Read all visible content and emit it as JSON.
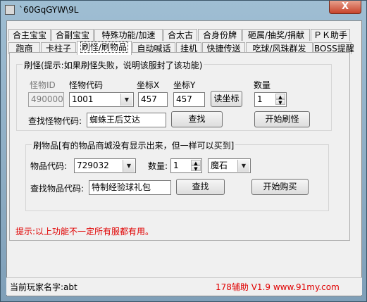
{
  "window": {
    "title": "`60GqGYW\\9L",
    "close_label": "X"
  },
  "tabs_row1": [
    {
      "label": "合主宝宝"
    },
    {
      "label": "合副宝宝"
    },
    {
      "label": "特殊功能/加速"
    },
    {
      "label": "合太古"
    },
    {
      "label": "合身份牌"
    },
    {
      "label": "砸属/抽奖/捐献"
    },
    {
      "label": "ＰＫ助手"
    }
  ],
  "tabs_row2": [
    {
      "label": "跑商"
    },
    {
      "label": "卡柱子"
    },
    {
      "label": "刷怪/刷物品",
      "active": true
    },
    {
      "label": "自动喊话"
    },
    {
      "label": "挂机"
    },
    {
      "label": "快捷传送"
    },
    {
      "label": "吃球/风珠群发"
    },
    {
      "label": "BOSS提醒"
    }
  ],
  "monster": {
    "group_title": "刷怪(提示:如果刷怪失败，说明该服封了该功能)",
    "id_label": "怪物ID",
    "code_label": "怪物代码",
    "x_label": "坐标X",
    "y_label": "坐标Y",
    "qty_label": "数量",
    "id_value": "490000",
    "code_value": "1001",
    "x_value": "457",
    "y_value": "457",
    "qty_value": "1",
    "read_coord_button": "读坐标",
    "search_label": "查找怪物代码:",
    "search_value": "蜘蛛王后艾达",
    "search_button": "查找",
    "start_button": "开始刷怪"
  },
  "item": {
    "group_title": "刷物品[有的物品商城没有显示出来，但一样可以买到]",
    "code_label": "物品代码:",
    "code_value": "729032",
    "qty_label": "数量:",
    "qty_value": "1",
    "currency_value": "魔石",
    "search_label": "查找物品代码:",
    "search_value": "特制经验球礼包",
    "search_button": "查找",
    "buy_button": "开始购买"
  },
  "hint": "提示:以上功能不一定所有服都有用。",
  "status": {
    "player_label": "当前玩家名字:abt",
    "brand": "178辅助 V1.9  www.91my.com"
  }
}
